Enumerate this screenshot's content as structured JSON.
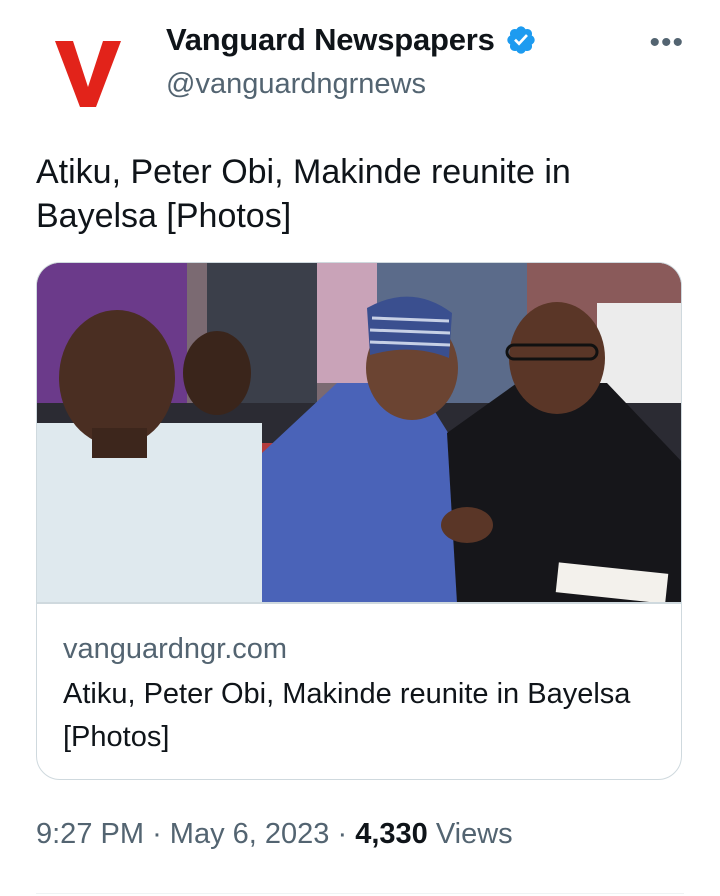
{
  "author": {
    "display_name": "Vanguard Newspapers",
    "handle": "@vanguardngrnews",
    "verified_icon": "verified-badge-icon",
    "avatar_logo": "V",
    "brand_color": "#e2231a",
    "verified_color": "#1d9bf0"
  },
  "more_label": "•••",
  "tweet": {
    "text": "Atiku, Peter Obi, Makinde reunite in Bayelsa [Photos]"
  },
  "card": {
    "image_icon": "photo-icon",
    "domain": "vanguardngr.com",
    "title": "Atiku, Peter Obi, Makinde reunite in Bayelsa [Photos]"
  },
  "meta": {
    "time": "9:27 PM",
    "separator": "·",
    "date": "May 6, 2023",
    "views_count": "4,330",
    "views_label": "Views"
  }
}
